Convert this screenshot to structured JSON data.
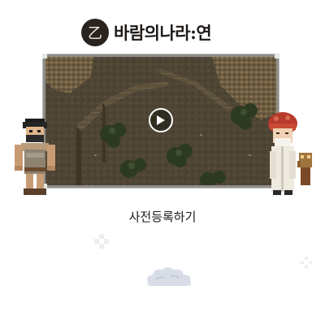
{
  "logo": {
    "text": "바람의나라:연",
    "emblem_glyph": "乙"
  },
  "video": {
    "play_icon": "play-icon"
  },
  "cta": {
    "label": "사전등록하기"
  },
  "colors": {
    "frame": "#8f8f8a",
    "ground": "#4a4232",
    "cliff": "#6b5a3f",
    "tree": "#2d3a22",
    "cloud": "#d9dde8"
  }
}
